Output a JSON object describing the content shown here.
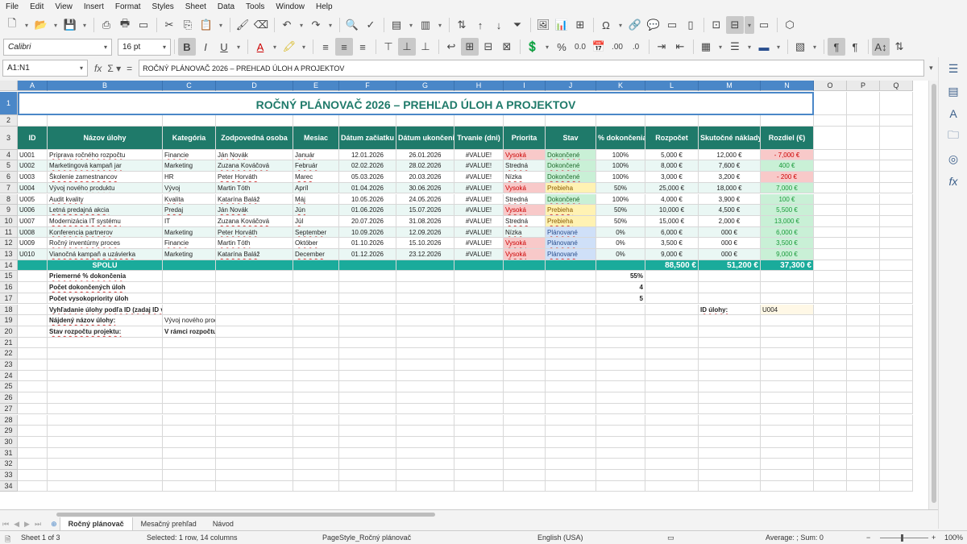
{
  "menu": [
    "File",
    "Edit",
    "View",
    "Insert",
    "Format",
    "Styles",
    "Sheet",
    "Data",
    "Tools",
    "Window",
    "Help"
  ],
  "font": {
    "name": "Calibri",
    "size": "16 pt"
  },
  "formula_bar": {
    "name_box": "A1:N1",
    "content": "ROČNÝ PLÁNOVAČ 2026 – PREHĽAD ÚLOH A PROJEKTOV"
  },
  "columns": [
    "A",
    "B",
    "C",
    "D",
    "E",
    "F",
    "G",
    "H",
    "I",
    "J",
    "K",
    "L",
    "M",
    "N",
    "O",
    "P",
    "Q"
  ],
  "title": "ROČNÝ PLÁNOVAČ 2026 – PREHĽAD ÚLOH A PROJEKTOV",
  "headers": [
    "ID",
    "Názov úlohy",
    "Kategória",
    "Zodpovedná osoba",
    "Mesiac",
    "Dátum začiatku",
    "Dátum ukončenia",
    "Trvanie (dni)",
    "Priorita",
    "Stav",
    "% dokončenia",
    "Rozpočet",
    "Skutočné náklady",
    "Rozdiel (€)"
  ],
  "tasks": [
    {
      "id": "U001",
      "name": "Príprava ročného rozpočtu",
      "cat": "Financie",
      "person": "Ján Novák",
      "month": "Január",
      "start": "12.01.2026",
      "end": "26.01.2026",
      "dur": "#VALUE!",
      "prio": "Vysoká",
      "status": "Dokončené",
      "pct": "100%",
      "budget": "5,000 €",
      "actual": "12,000 €",
      "diff": "- 7,000 €"
    },
    {
      "id": "U002",
      "name": "Marketingová kampaň jar",
      "cat": "Marketing",
      "person": "Zuzana Kováčová",
      "month": "Február",
      "start": "02.02.2026",
      "end": "28.02.2026",
      "dur": "#VALUE!",
      "prio": "Stredná",
      "status": "Dokončené",
      "pct": "100%",
      "budget": "8,000 €",
      "actual": "7,600 €",
      "diff": "400 €"
    },
    {
      "id": "U003",
      "name": "Školenie zamestnancov",
      "cat": "HR",
      "person": "Peter Horváth",
      "month": "Marec",
      "start": "05.03.2026",
      "end": "20.03.2026",
      "dur": "#VALUE!",
      "prio": "Nízka",
      "status": "Dokončené",
      "pct": "100%",
      "budget": "3,000 €",
      "actual": "3,200 €",
      "diff": "- 200 €"
    },
    {
      "id": "U004",
      "name": "Vývoj nového produktu",
      "cat": "Vývoj",
      "person": "Martin Tóth",
      "month": "Apríl",
      "start": "01.04.2026",
      "end": "30.06.2026",
      "dur": "#VALUE!",
      "prio": "Vysoká",
      "status": "Prebieha",
      "pct": "50%",
      "budget": "25,000 €",
      "actual": "18,000 €",
      "diff": "7,000 €"
    },
    {
      "id": "U005",
      "name": "Audit kvality",
      "cat": "Kvalita",
      "person": "Katarína Baláž",
      "month": "Máj",
      "start": "10.05.2026",
      "end": "24.05.2026",
      "dur": "#VALUE!",
      "prio": "Stredná",
      "status": "Dokončené",
      "pct": "100%",
      "budget": "4,000 €",
      "actual": "3,900 €",
      "diff": "100 €"
    },
    {
      "id": "U006",
      "name": "Letná predajná akcia",
      "cat": "Predaj",
      "person": "Ján Novák",
      "month": "Jún",
      "start": "01.06.2026",
      "end": "15.07.2026",
      "dur": "#VALUE!",
      "prio": "Vysoká",
      "status": "Prebieha",
      "pct": "50%",
      "budget": "10,000 €",
      "actual": "4,500 €",
      "diff": "5,500 €"
    },
    {
      "id": "U007",
      "name": "Modernizácia IT systému",
      "cat": "IT",
      "person": "Zuzana Kováčová",
      "month": "Júl",
      "start": "20.07.2026",
      "end": "31.08.2026",
      "dur": "#VALUE!",
      "prio": "Stredná",
      "status": "Prebieha",
      "pct": "50%",
      "budget": "15,000 €",
      "actual": "2,000 €",
      "diff": "13,000 €"
    },
    {
      "id": "U008",
      "name": "Konferencia partnerov",
      "cat": "Marketing",
      "person": "Peter Horváth",
      "month": "September",
      "start": "10.09.2026",
      "end": "12.09.2026",
      "dur": "#VALUE!",
      "prio": "Nízka",
      "status": "Plánované",
      "pct": "0%",
      "budget": "6,000 €",
      "actual": "000 €",
      "diff": "6,000 €"
    },
    {
      "id": "U009",
      "name": "Ročný inventúrny proces",
      "cat": "Financie",
      "person": "Martin Tóth",
      "month": "Október",
      "start": "01.10.2026",
      "end": "15.10.2026",
      "dur": "#VALUE!",
      "prio": "Vysoká",
      "status": "Plánované",
      "pct": "0%",
      "budget": "3,500 €",
      "actual": "000 €",
      "diff": "3,500 €"
    },
    {
      "id": "U010",
      "name": "Vianočná kampaň a uzávierka",
      "cat": "Marketing",
      "person": "Katarína Baláž",
      "month": "December",
      "start": "01.12.2026",
      "end": "23.12.2026",
      "dur": "#VALUE!",
      "prio": "Vysoká",
      "status": "Plánované",
      "pct": "0%",
      "budget": "9,000 €",
      "actual": "000 €",
      "diff": "9,000 €"
    }
  ],
  "totals": {
    "label": "SPOLU",
    "budget": "88,500 €",
    "actual": "51,200 €",
    "diff": "37,300 €"
  },
  "summary": [
    {
      "label": "Priemerné % dokončenia",
      "value": "55%"
    },
    {
      "label": "Počet dokončených úloh",
      "value": "4"
    },
    {
      "label": "Počet vysokopriority úloh",
      "value": "5"
    }
  ],
  "lookup": {
    "label": "Vyhľadanie úlohy podľa ID (zadaj ID vpravo)",
    "id_label": "ID úlohy:",
    "id_value": "U004",
    "found_label": "Nájdený názov úlohy:",
    "found_value": "Vývoj nového produktu",
    "budget_label": "Stav rozpočtu projektu:",
    "budget_value": "V rámci rozpočtu"
  },
  "row_numbers": [
    "1",
    "2",
    "3",
    "4",
    "5",
    "6",
    "7",
    "8",
    "9",
    "10",
    "11",
    "12",
    "13",
    "14",
    "15",
    "16",
    "17",
    "18",
    "19",
    "20",
    "21",
    "22",
    "23",
    "24",
    "25",
    "26",
    "27",
    "28",
    "29",
    "30",
    "31",
    "32",
    "33",
    "34"
  ],
  "sheet_tabs": [
    "Ročný plánovač",
    "Mesačný prehľad",
    "Návod"
  ],
  "status": {
    "sheet": "Sheet 1 of 3",
    "selection": "Selected: 1 row, 14 columns",
    "pagestyle": "PageStyle_Ročný plánovač",
    "language": "English (USA)",
    "summary": "Average: ; Sum: 0",
    "zoom": "100%"
  },
  "colors": {
    "accent": "#1aab9b",
    "title": "#1f7a6a",
    "header_bg": "#1f7a6a",
    "red_bg": "#f8c9c9",
    "green_bg": "#c9f0d6",
    "yellow_bg": "#fff2b3",
    "blue_bg": "#cfe0f8",
    "stripe": "#eaf7f4"
  }
}
